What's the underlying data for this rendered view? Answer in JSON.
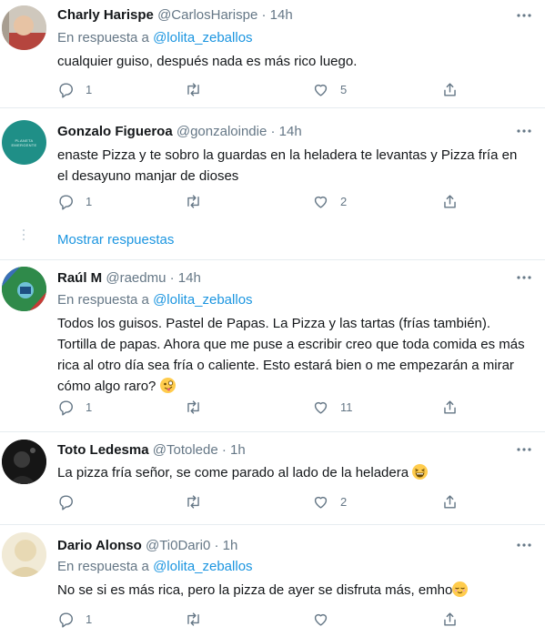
{
  "tweets": [
    {
      "name": "Charly Harispe",
      "handle": "@CarlosHarispe",
      "sep": "·",
      "time": "14h",
      "reply_prefix": "En respuesta a",
      "reply_handle": "@lolita_zeballos",
      "text": "cualquier guiso, después nada es más rico luego.",
      "replies": "1",
      "retweets": "",
      "likes": "5"
    },
    {
      "name": "Gonzalo Figueroa",
      "handle": "@gonzaloindie",
      "sep": "·",
      "time": "14h",
      "avatar_text": "PLANETA EMERGENTE",
      "text": "enaste Pizza y te sobro la guardas en la heladera te levantas y  Pizza fría en el desayuno manjar de dioses",
      "replies": "1",
      "retweets": "",
      "likes": "2"
    },
    {
      "name": "Raúl M",
      "handle": "@raedmu",
      "sep": "·",
      "time": "14h",
      "reply_prefix": "En respuesta a",
      "reply_handle": "@lolita_zeballos",
      "text": "Todos los guisos. Pastel de Papas. La Pizza y las tartas (frías también). Tortilla de papas. Ahora que me puse a escribir creo que toda comida es más rica al otro día sea fría o caliente. Esto estará bien o me empezarán a mirar cómo algo raro?",
      "emoji": "zany-face",
      "replies": "1",
      "retweets": "",
      "likes": "11"
    },
    {
      "name": "Toto Ledesma",
      "handle": "@Totolede",
      "sep": "·",
      "time": "1h",
      "text": "La pizza fría señor, se come parado al lado de la heladera",
      "emoji": "grinning-squinting-face",
      "replies": "",
      "retweets": "",
      "likes": "2"
    },
    {
      "name": "Dario Alonso",
      "handle": "@Ti0Dari0",
      "sep": "·",
      "time": "1h",
      "reply_prefix": "En respuesta a",
      "reply_handle": "@lolita_zeballos",
      "text": "No se si es más rica, pero la pizza de ayer se disfruta más, emho",
      "emoji": "relieved-face",
      "replies": "1",
      "retweets": "",
      "likes": ""
    }
  ],
  "show_replies": "Mostrar respuestas",
  "colors": {
    "link": "#1b95e0",
    "muted": "#657786",
    "divider": "#e6ecf0"
  }
}
